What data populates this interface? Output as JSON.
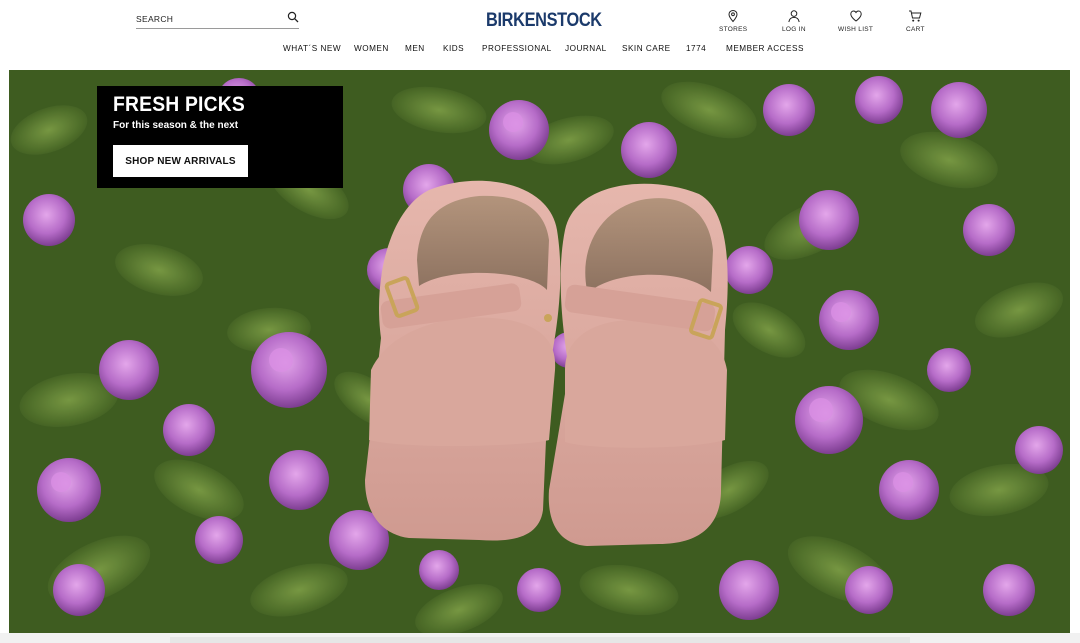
{
  "brand": {
    "logo_text": "BIRKENSTOCK",
    "logo_color": "#1b3a6b"
  },
  "search": {
    "placeholder": "SEARCH",
    "icon": "search-icon"
  },
  "utility_nav": [
    {
      "label": "STORES",
      "icon": "location-pin-icon"
    },
    {
      "label": "LOG IN",
      "icon": "user-icon"
    },
    {
      "label": "WISH LIST",
      "icon": "heart-icon"
    },
    {
      "label": "CART",
      "icon": "cart-icon"
    }
  ],
  "main_nav": [
    {
      "label": "WHAT´S NEW"
    },
    {
      "label": "WOMEN"
    },
    {
      "label": "MEN"
    },
    {
      "label": "KIDS"
    },
    {
      "label": "PROFESSIONAL"
    },
    {
      "label": "JOURNAL"
    },
    {
      "label": "SKIN CARE"
    },
    {
      "label": "1774"
    },
    {
      "label": "MEMBER ACCESS"
    }
  ],
  "hero": {
    "image": "pink-suede-clogs-in-purple-flowers",
    "promo": {
      "title": "FRESH PICKS",
      "subtitle": "For this season & the next",
      "cta_label": "SHOP NEW ARRIVALS"
    },
    "colors": {
      "foliage": "#4a6b28",
      "flowers": "#b66cc8",
      "clog": "#dba9a0"
    }
  }
}
